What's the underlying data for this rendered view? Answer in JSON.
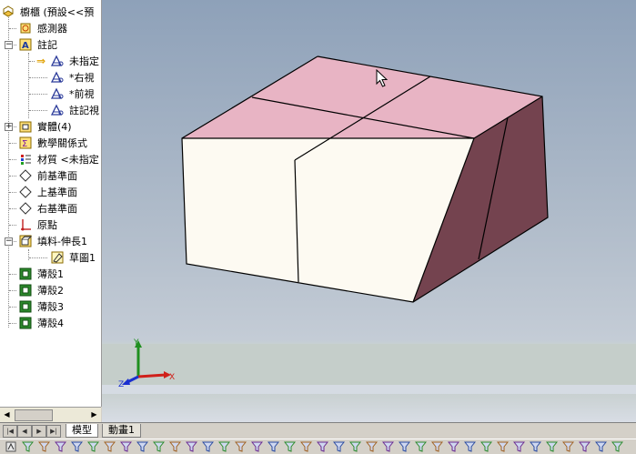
{
  "feature_tree": {
    "root": {
      "label": "櫥櫃 (預設<<預",
      "icon": "part-icon"
    },
    "items": [
      {
        "id": "sensors",
        "label": "感測器",
        "icon": "sensor-icon",
        "level": 1
      },
      {
        "id": "annotations",
        "label": "註記",
        "icon": "annotation-icon",
        "level": 1,
        "expander": "−"
      },
      {
        "id": "annotation-unspecified",
        "label": "未指定",
        "icon": "notes-view-icon",
        "level": 2,
        "arrow": true
      },
      {
        "id": "annotation-right",
        "label": "*右視",
        "icon": "notes-view-icon",
        "level": 2
      },
      {
        "id": "annotation-front",
        "label": "*前視",
        "icon": "notes-view-icon",
        "level": 2
      },
      {
        "id": "annotation-notes",
        "label": "註記視",
        "icon": "notes-view-icon",
        "level": 2
      },
      {
        "id": "solid-bodies",
        "label": "實體(4)",
        "icon": "solid-bodies-folder-icon",
        "level": 1,
        "expander": "+"
      },
      {
        "id": "equations",
        "label": "數學關係式",
        "icon": "equations-icon",
        "level": 1
      },
      {
        "id": "material",
        "label": "材質 <未指定",
        "icon": "material-icon",
        "level": 1
      },
      {
        "id": "front-plane",
        "label": "前基準面",
        "icon": "plane-icon",
        "level": 1
      },
      {
        "id": "top-plane",
        "label": "上基準面",
        "icon": "plane-icon",
        "level": 1
      },
      {
        "id": "right-plane",
        "label": "右基準面",
        "icon": "plane-icon",
        "level": 1
      },
      {
        "id": "origin",
        "label": "原點",
        "icon": "origin-icon",
        "level": 1
      },
      {
        "id": "boss-extrude",
        "label": "填料-伸長1",
        "icon": "extrude-icon",
        "level": 1,
        "expander": "−"
      },
      {
        "id": "sketch1",
        "label": "草圖1",
        "icon": "sketch-icon",
        "level": 2
      },
      {
        "id": "shell1",
        "label": "薄殼1",
        "icon": "shell-icon",
        "level": 1
      },
      {
        "id": "shell2",
        "label": "薄殼2",
        "icon": "shell-icon",
        "level": 1
      },
      {
        "id": "shell3",
        "label": "薄殼3",
        "icon": "shell-icon",
        "level": 1
      },
      {
        "id": "shell4",
        "label": "薄殼4",
        "icon": "shell-icon",
        "level": 1
      }
    ]
  },
  "tabs": {
    "model": "模型",
    "animation": "動畫1"
  },
  "triad": {
    "x": "X",
    "y": "Y",
    "z": "Z"
  },
  "colors": {
    "top_face": "#e8b4c4",
    "front_face": "#fdfaf2",
    "side_face": "#74434f",
    "edge": "#000000",
    "axis_x": "#d0201a",
    "axis_y": "#1f8f1f",
    "axis_z": "#1a2fd0"
  },
  "icons": {
    "tab_nav": [
      "first-tab-icon",
      "prev-tab-icon",
      "next-tab-icon",
      "last-tab-icon"
    ],
    "bottom_toolbar": [
      "view-orientation-icon",
      "filter-icon",
      "filter-icon",
      "filter-icon",
      "filter-icon",
      "filter-icon",
      "filter-icon",
      "filter-icon",
      "filter-icon",
      "filter-icon",
      "filter-icon",
      "filter-icon",
      "filter-icon",
      "filter-icon",
      "filter-icon",
      "filter-icon",
      "filter-icon",
      "filter-icon",
      "filter-icon",
      "filter-icon",
      "filter-icon",
      "filter-icon",
      "filter-icon",
      "filter-icon",
      "filter-icon",
      "filter-icon",
      "filter-icon",
      "filter-icon",
      "filter-icon",
      "filter-icon",
      "filter-icon",
      "filter-icon",
      "filter-icon",
      "filter-icon",
      "filter-icon",
      "filter-icon",
      "filter-icon",
      "filter-icon"
    ]
  }
}
